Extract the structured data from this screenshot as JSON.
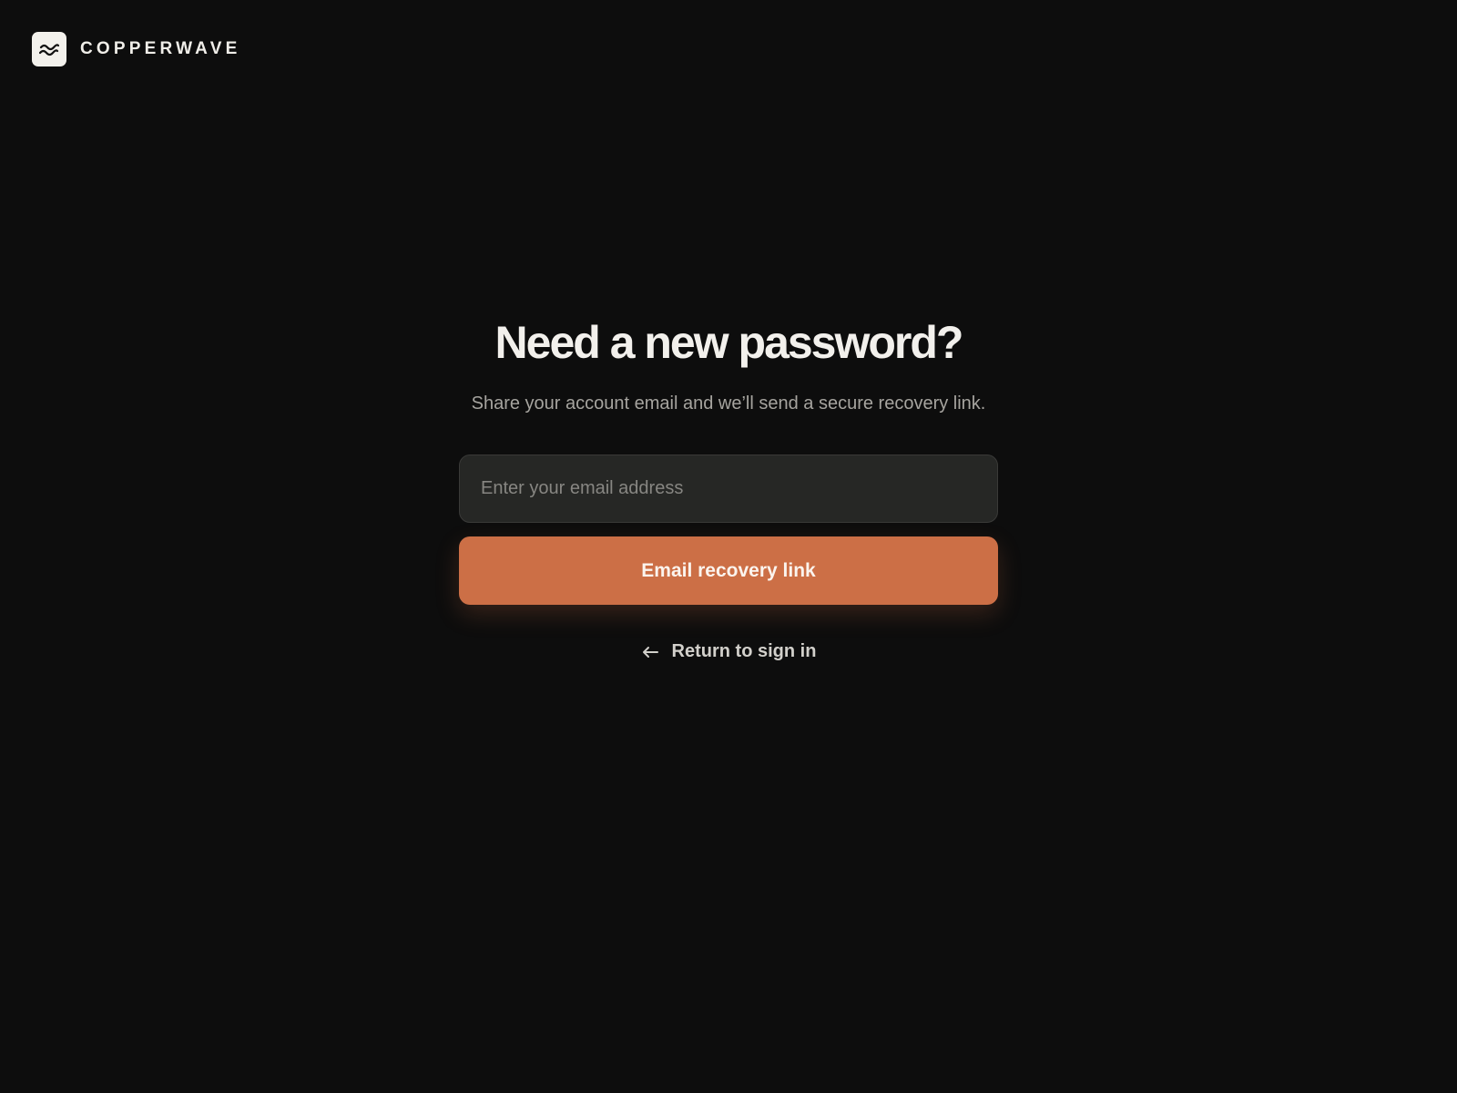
{
  "brand": {
    "name": "COPPERWAVE",
    "logo_icon": "wave-logo-icon"
  },
  "recovery": {
    "title": "Need a new password?",
    "subtitle": "Share your account email and we’ll send a secure recovery link.",
    "email_value": "",
    "email_placeholder": "Enter your email address",
    "submit_label": "Email recovery link",
    "back_label": "Return to sign in",
    "back_icon": "arrow-left-icon"
  },
  "colors": {
    "background": "#0d0d0d",
    "accent": "#cc6f46",
    "input_background": "#262725",
    "text_primary": "#f2f0ec",
    "text_secondary": "#a6a49f"
  }
}
